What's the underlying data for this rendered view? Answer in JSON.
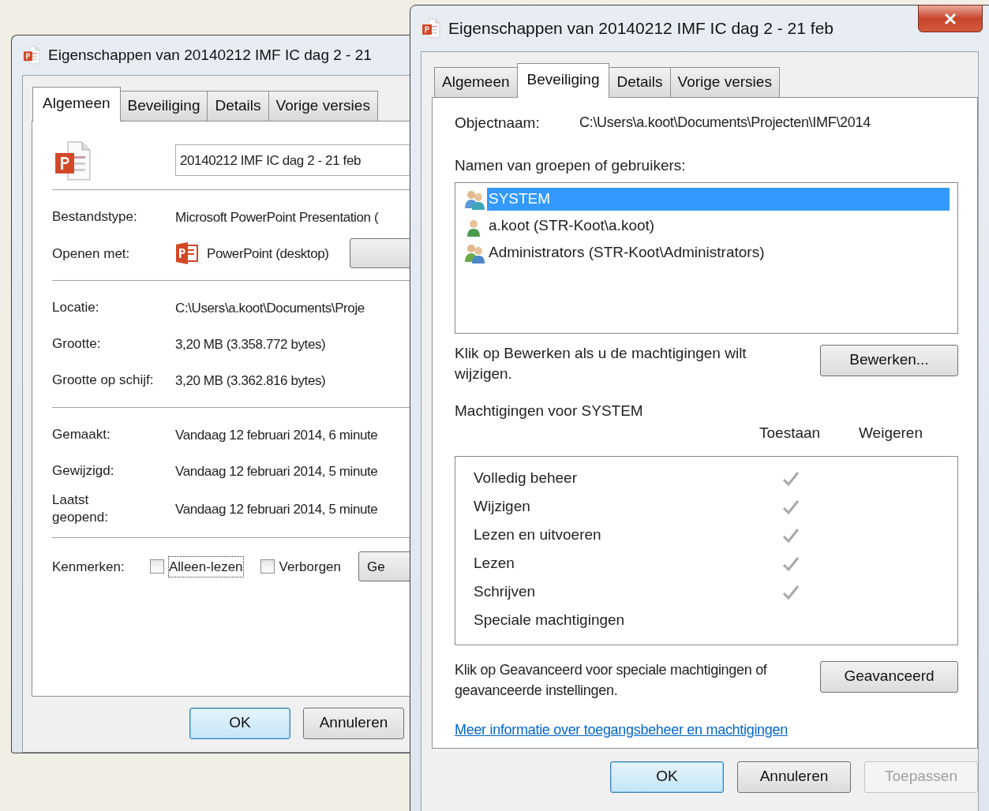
{
  "back_window": {
    "title": "Eigenschappen van 20140212 IMF IC dag 2 - 21",
    "tabs": [
      {
        "label": "Algemeen",
        "selected": true
      },
      {
        "label": "Beveiliging",
        "selected": false
      },
      {
        "label": "Details",
        "selected": false
      },
      {
        "label": "Vorige versies",
        "selected": false
      }
    ],
    "file_name": "20140212 IMF IC dag 2 - 21 feb",
    "type_row": {
      "label": "Bestandstype:",
      "value": "Microsoft PowerPoint Presentation ("
    },
    "open_with": {
      "label": "Openen met:",
      "value": "PowerPoint (desktop)"
    },
    "size_rows": [
      {
        "label": "Locatie:",
        "value": "C:\\Users\\a.koot\\Documents\\Proje"
      },
      {
        "label": "Grootte:",
        "value": "3,20 MB (3.358.772 bytes)"
      },
      {
        "label": "Grootte op schijf:",
        "value": "3,20 MB (3.362.816 bytes)"
      }
    ],
    "date_rows": [
      {
        "label": "Gemaakt:",
        "value": "Vandaag 12 februari 2014, 6 minute"
      },
      {
        "label": "Gewijzigd:",
        "value": "Vandaag 12 februari 2014, 5 minute"
      },
      {
        "label": "Laatst geopend:",
        "value": "Vandaag 12 februari 2014, 5 minute"
      }
    ],
    "attributes": {
      "label": "Kenmerken:",
      "checkboxes": [
        {
          "label": "Alleen-lezen",
          "checked": false,
          "focused": true
        },
        {
          "label": "Verborgen",
          "checked": false,
          "focused": false
        }
      ],
      "button": "Ge"
    },
    "buttons": [
      {
        "label": "OK",
        "default": true
      },
      {
        "label": "Annuleren",
        "default": false
      }
    ]
  },
  "front_window": {
    "title": "Eigenschappen van 20140212 IMF IC dag 2 - 21 feb",
    "tabs": [
      {
        "label": "Algemeen",
        "selected": false
      },
      {
        "label": "Beveiliging",
        "selected": true
      },
      {
        "label": "Details",
        "selected": false
      },
      {
        "label": "Vorige versies",
        "selected": false
      }
    ],
    "object_name": {
      "label": "Objectnaam:",
      "value": "C:\\Users\\a.koot\\Documents\\Projecten\\IMF\\2014"
    },
    "principals": {
      "label": "Namen van groepen of gebruikers:",
      "items": [
        {
          "name": "SYSTEM",
          "kind": "system",
          "selected": true
        },
        {
          "name": "a.koot (STR-Koot\\a.koot)",
          "kind": "user",
          "selected": false
        },
        {
          "name": "Administrators (STR-Koot\\Administrators)",
          "kind": "group",
          "selected": false
        }
      ]
    },
    "edit_hint": "Klik op Bewerken als u de machtigingen wilt wijzigen.",
    "edit_button": "Bewerken...",
    "permissions": {
      "title": "Machtigingen voor SYSTEM",
      "columns": [
        "Toestaan",
        "Weigeren"
      ],
      "rows": [
        {
          "name": "Volledig beheer",
          "allow": true,
          "deny": false
        },
        {
          "name": "Wijzigen",
          "allow": true,
          "deny": false
        },
        {
          "name": "Lezen en uitvoeren",
          "allow": true,
          "deny": false
        },
        {
          "name": "Lezen",
          "allow": true,
          "deny": false
        },
        {
          "name": "Schrijven",
          "allow": true,
          "deny": false
        },
        {
          "name": "Speciale machtigingen",
          "allow": false,
          "deny": false
        }
      ]
    },
    "advanced_hint": "Klik op Geavanceerd voor speciale machtigingen of geavanceerde instellingen.",
    "advanced_button": "Geavanceerd",
    "link": "Meer informatie over toegangsbeheer en machtigingen",
    "buttons": [
      {
        "label": "OK",
        "default": true,
        "disabled": false
      },
      {
        "label": "Annuleren",
        "default": false,
        "disabled": false
      },
      {
        "label": "Toepassen",
        "default": false,
        "disabled": true
      }
    ]
  }
}
